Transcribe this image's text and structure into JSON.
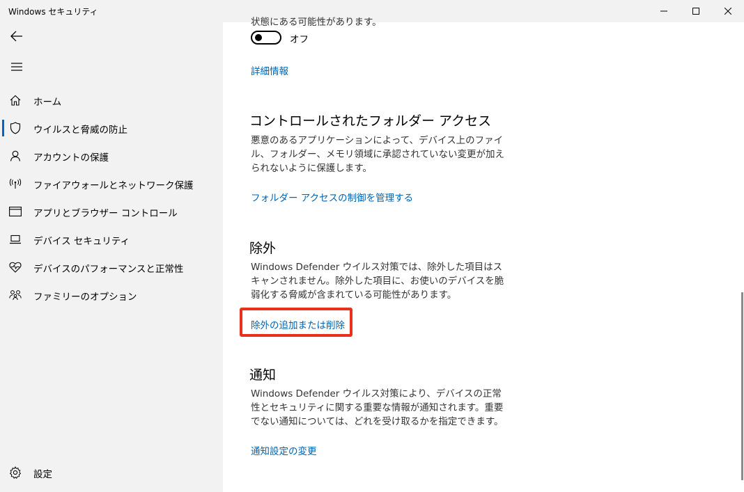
{
  "window": {
    "title": "Windows セキュリティ"
  },
  "sidebar": {
    "items": [
      {
        "label": "ホーム",
        "icon": "home-icon",
        "selected": false
      },
      {
        "label": "ウイルスと脅威の防止",
        "icon": "shield-icon",
        "selected": true
      },
      {
        "label": "アカウントの保護",
        "icon": "person-icon",
        "selected": false
      },
      {
        "label": "ファイアウォールとネットワーク保護",
        "icon": "wireless-icon",
        "selected": false
      },
      {
        "label": "アプリとブラウザー コントロール",
        "icon": "app-browser-icon",
        "selected": false
      },
      {
        "label": "デバイス セキュリティ",
        "icon": "laptop-icon",
        "selected": false
      },
      {
        "label": "デバイスのパフォーマンスと正常性",
        "icon": "heart-pulse-icon",
        "selected": false
      },
      {
        "label": "ファミリーのオプション",
        "icon": "family-icon",
        "selected": false
      }
    ],
    "settings_label": "設定"
  },
  "main": {
    "cut_off_text": "状態にある可能性があります。",
    "toggle": {
      "label": "オフ",
      "state": "off"
    },
    "details_link": "詳細情報",
    "sections": [
      {
        "title": "コントロールされたフォルダー アクセス",
        "description": "悪意のあるアプリケーションによって、デバイス上のファイル、フォルダー、メモリ領域に承認されていない変更が加えられないように保護します。",
        "link": "フォルダー アクセスの制御を管理する"
      },
      {
        "title": "除外",
        "description": "Windows Defender ウイルス対策では、除外した項目はスキャンされません。除外した項目に、お使いのデバイスを脆弱化する脅威が含まれている可能性があります。",
        "link": "除外の追加または削除"
      },
      {
        "title": "通知",
        "description": "Windows Defender ウイルス対策により、デバイスの正常性とセキュリティに関する重要な情報が通知されます。重要でない通知については、どれを受け取るかを指定できます。",
        "link": "通知設定の変更"
      }
    ]
  },
  "colors": {
    "accent": "#0063b1",
    "highlight": "#e8301c",
    "sidebar_bg": "#f2f2f2"
  }
}
